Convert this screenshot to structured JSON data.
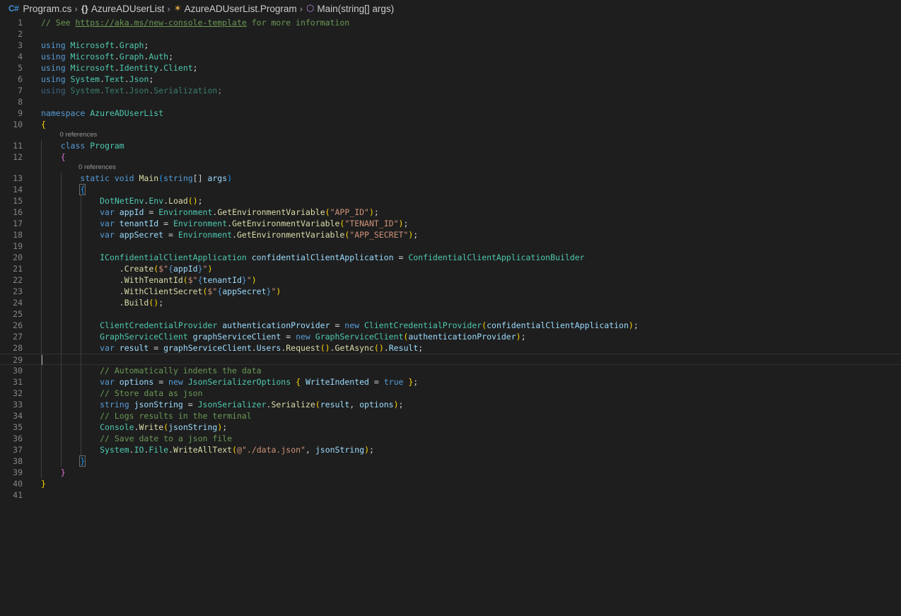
{
  "breadcrumb": {
    "file_icon": "C#",
    "file": "Program.cs",
    "namespace_icon": "{}",
    "namespace": "AzureADUserList",
    "class": "AzureADUserList.Program",
    "method": "Main(string[] args)"
  },
  "lens": {
    "class_refs": "0 references",
    "method_refs": "0 references"
  },
  "lines": [
    {
      "n": "1",
      "tokens": [
        [
          "c",
          "// See "
        ],
        [
          "link",
          "https://aka.ms/new-console-template"
        ],
        [
          "c",
          " for more information"
        ]
      ]
    },
    {
      "n": "2",
      "tokens": []
    },
    {
      "n": "3",
      "tokens": [
        [
          "k",
          "using "
        ],
        [
          "t",
          "Microsoft"
        ],
        [
          "p",
          "."
        ],
        [
          "t",
          "Graph"
        ],
        [
          "p",
          ";"
        ]
      ]
    },
    {
      "n": "4",
      "tokens": [
        [
          "k",
          "using "
        ],
        [
          "t",
          "Microsoft"
        ],
        [
          "p",
          "."
        ],
        [
          "t",
          "Graph"
        ],
        [
          "p",
          "."
        ],
        [
          "t",
          "Auth"
        ],
        [
          "p",
          ";"
        ]
      ]
    },
    {
      "n": "5",
      "tokens": [
        [
          "k",
          "using "
        ],
        [
          "t",
          "Microsoft"
        ],
        [
          "p",
          "."
        ],
        [
          "t",
          "Identity"
        ],
        [
          "p",
          "."
        ],
        [
          "t",
          "Client"
        ],
        [
          "p",
          ";"
        ]
      ]
    },
    {
      "n": "6",
      "tokens": [
        [
          "k",
          "using "
        ],
        [
          "t",
          "System"
        ],
        [
          "p",
          "."
        ],
        [
          "t",
          "Text"
        ],
        [
          "p",
          "."
        ],
        [
          "t",
          "Json"
        ],
        [
          "p",
          ";"
        ]
      ]
    },
    {
      "n": "7",
      "dim": true,
      "tokens": [
        [
          "k",
          "using "
        ],
        [
          "t",
          "System"
        ],
        [
          "p",
          "."
        ],
        [
          "t",
          "Text"
        ],
        [
          "p",
          "."
        ],
        [
          "t",
          "Json"
        ],
        [
          "p",
          "."
        ],
        [
          "t",
          "Serialization"
        ],
        [
          "p",
          ";"
        ]
      ]
    },
    {
      "n": "8",
      "tokens": []
    },
    {
      "n": "9",
      "tokens": [
        [
          "k",
          "namespace "
        ],
        [
          "t",
          "AzureADUserList"
        ]
      ]
    },
    {
      "n": "10",
      "tokens": [
        [
          "b1",
          "{"
        ]
      ]
    },
    {
      "lens": "class_refs",
      "indent": 4
    },
    {
      "n": "11",
      "tokens": [
        [
          "p",
          "    "
        ],
        [
          "k",
          "class "
        ],
        [
          "t",
          "Program"
        ]
      ]
    },
    {
      "n": "12",
      "tokens": [
        [
          "p",
          "    "
        ],
        [
          "b2",
          "{"
        ]
      ]
    },
    {
      "lens": "method_refs",
      "indent": 8
    },
    {
      "n": "13",
      "tokens": [
        [
          "p",
          "        "
        ],
        [
          "k",
          "static void "
        ],
        [
          "f",
          "Main"
        ],
        [
          "b3",
          "("
        ],
        [
          "k",
          "string"
        ],
        [
          "p",
          "[] "
        ],
        [
          "v",
          "args"
        ],
        [
          "b3",
          ")"
        ]
      ]
    },
    {
      "n": "14",
      "tokens": [
        [
          "p",
          "        "
        ],
        [
          "b3bm",
          "{"
        ]
      ]
    },
    {
      "n": "15",
      "tokens": [
        [
          "p",
          "            "
        ],
        [
          "t",
          "DotNetEnv"
        ],
        [
          "p",
          "."
        ],
        [
          "t",
          "Env"
        ],
        [
          "p",
          "."
        ],
        [
          "f",
          "Load"
        ],
        [
          "b1",
          "()"
        ],
        [
          "p",
          ";"
        ]
      ]
    },
    {
      "n": "16",
      "tokens": [
        [
          "p",
          "            "
        ],
        [
          "k",
          "var "
        ],
        [
          "v",
          "appId"
        ],
        [
          "p",
          " = "
        ],
        [
          "t",
          "Environment"
        ],
        [
          "p",
          "."
        ],
        [
          "f",
          "GetEnvironmentVariable"
        ],
        [
          "b1",
          "("
        ],
        [
          "s",
          "\"APP_ID\""
        ],
        [
          "b1",
          ")"
        ],
        [
          "p",
          ";"
        ]
      ]
    },
    {
      "n": "17",
      "tokens": [
        [
          "p",
          "            "
        ],
        [
          "k",
          "var "
        ],
        [
          "v",
          "tenantId"
        ],
        [
          "p",
          " = "
        ],
        [
          "t",
          "Environment"
        ],
        [
          "p",
          "."
        ],
        [
          "f",
          "GetEnvironmentVariable"
        ],
        [
          "b1",
          "("
        ],
        [
          "s",
          "\"TENANT_ID\""
        ],
        [
          "b1",
          ")"
        ],
        [
          "p",
          ";"
        ]
      ]
    },
    {
      "n": "18",
      "tokens": [
        [
          "p",
          "            "
        ],
        [
          "k",
          "var "
        ],
        [
          "v",
          "appSecret"
        ],
        [
          "p",
          " = "
        ],
        [
          "t",
          "Environment"
        ],
        [
          "p",
          "."
        ],
        [
          "f",
          "GetEnvironmentVariable"
        ],
        [
          "b1",
          "("
        ],
        [
          "s",
          "\"APP_SECRET\""
        ],
        [
          "b1",
          ")"
        ],
        [
          "p",
          ";"
        ]
      ]
    },
    {
      "n": "19",
      "tokens": []
    },
    {
      "n": "20",
      "tokens": [
        [
          "p",
          "            "
        ],
        [
          "t",
          "IConfidentialClientApplication "
        ],
        [
          "v",
          "confidentialClientApplication"
        ],
        [
          "p",
          " = "
        ],
        [
          "t",
          "ConfidentialClientApplicationBuilder"
        ]
      ]
    },
    {
      "n": "21",
      "tokens": [
        [
          "p",
          "                ."
        ],
        [
          "f",
          "Create"
        ],
        [
          "b1",
          "("
        ],
        [
          "s",
          "$\""
        ],
        [
          "k",
          "{"
        ],
        [
          "v",
          "appId"
        ],
        [
          "k",
          "}"
        ],
        [
          "s",
          "\""
        ],
        [
          "b1",
          ")"
        ]
      ]
    },
    {
      "n": "22",
      "tokens": [
        [
          "p",
          "                ."
        ],
        [
          "f",
          "WithTenantId"
        ],
        [
          "b1",
          "("
        ],
        [
          "s",
          "$\""
        ],
        [
          "k",
          "{"
        ],
        [
          "v",
          "tenantId"
        ],
        [
          "k",
          "}"
        ],
        [
          "s",
          "\""
        ],
        [
          "b1",
          ")"
        ]
      ]
    },
    {
      "n": "23",
      "tokens": [
        [
          "p",
          "                ."
        ],
        [
          "f",
          "WithClientSecret"
        ],
        [
          "b1",
          "("
        ],
        [
          "s",
          "$\""
        ],
        [
          "k",
          "{"
        ],
        [
          "v",
          "appSecret"
        ],
        [
          "k",
          "}"
        ],
        [
          "s",
          "\""
        ],
        [
          "b1",
          ")"
        ]
      ]
    },
    {
      "n": "24",
      "tokens": [
        [
          "p",
          "                ."
        ],
        [
          "f",
          "Build"
        ],
        [
          "b1",
          "()"
        ],
        [
          "p",
          ";"
        ]
      ]
    },
    {
      "n": "25",
      "tokens": []
    },
    {
      "n": "26",
      "tokens": [
        [
          "p",
          "            "
        ],
        [
          "t",
          "ClientCredentialProvider "
        ],
        [
          "v",
          "authenticationProvider"
        ],
        [
          "p",
          " = "
        ],
        [
          "k",
          "new "
        ],
        [
          "t",
          "ClientCredentialProvider"
        ],
        [
          "b1",
          "("
        ],
        [
          "v",
          "confidentialClientApplication"
        ],
        [
          "b1",
          ")"
        ],
        [
          "p",
          ";"
        ]
      ]
    },
    {
      "n": "27",
      "tokens": [
        [
          "p",
          "            "
        ],
        [
          "t",
          "GraphServiceClient "
        ],
        [
          "v",
          "graphServiceClient"
        ],
        [
          "p",
          " = "
        ],
        [
          "k",
          "new "
        ],
        [
          "t",
          "GraphServiceClient"
        ],
        [
          "b1",
          "("
        ],
        [
          "v",
          "authenticationProvider"
        ],
        [
          "b1",
          ")"
        ],
        [
          "p",
          ";"
        ]
      ]
    },
    {
      "n": "28",
      "tokens": [
        [
          "p",
          "            "
        ],
        [
          "k",
          "var "
        ],
        [
          "v",
          "result"
        ],
        [
          "p",
          " = "
        ],
        [
          "v",
          "graphServiceClient"
        ],
        [
          "p",
          "."
        ],
        [
          "v",
          "Users"
        ],
        [
          "p",
          "."
        ],
        [
          "f",
          "Request"
        ],
        [
          "b1",
          "()"
        ],
        [
          "p",
          "."
        ],
        [
          "f",
          "GetAsync"
        ],
        [
          "b1",
          "()"
        ],
        [
          "p",
          "."
        ],
        [
          "v",
          "Result"
        ],
        [
          "p",
          ";"
        ]
      ]
    },
    {
      "n": "29",
      "current": true,
      "tokens": []
    },
    {
      "n": "30",
      "tokens": [
        [
          "p",
          "            "
        ],
        [
          "c",
          "// Automatically indents the data"
        ]
      ]
    },
    {
      "n": "31",
      "tokens": [
        [
          "p",
          "            "
        ],
        [
          "k",
          "var "
        ],
        [
          "v",
          "options"
        ],
        [
          "p",
          " = "
        ],
        [
          "k",
          "new "
        ],
        [
          "t",
          "JsonSerializerOptions "
        ],
        [
          "b1",
          "{ "
        ],
        [
          "v",
          "WriteIndented"
        ],
        [
          "p",
          " = "
        ],
        [
          "k",
          "true"
        ],
        [
          "b1",
          " }"
        ],
        [
          "p",
          ";"
        ]
      ]
    },
    {
      "n": "32",
      "tokens": [
        [
          "p",
          "            "
        ],
        [
          "c",
          "// Store data as json"
        ]
      ]
    },
    {
      "n": "33",
      "tokens": [
        [
          "p",
          "            "
        ],
        [
          "k",
          "string "
        ],
        [
          "v",
          "jsonString"
        ],
        [
          "p",
          " = "
        ],
        [
          "t",
          "JsonSerializer"
        ],
        [
          "p",
          "."
        ],
        [
          "f",
          "Serialize"
        ],
        [
          "b1",
          "("
        ],
        [
          "v",
          "result"
        ],
        [
          "p",
          ", "
        ],
        [
          "v",
          "options"
        ],
        [
          "b1",
          ")"
        ],
        [
          "p",
          ";"
        ]
      ]
    },
    {
      "n": "34",
      "tokens": [
        [
          "p",
          "            "
        ],
        [
          "c",
          "// Logs results in the terminal"
        ]
      ]
    },
    {
      "n": "35",
      "tokens": [
        [
          "p",
          "            "
        ],
        [
          "t",
          "Console"
        ],
        [
          "p",
          "."
        ],
        [
          "f",
          "Write"
        ],
        [
          "b1",
          "("
        ],
        [
          "v",
          "jsonString"
        ],
        [
          "b1",
          ")"
        ],
        [
          "p",
          ";"
        ]
      ]
    },
    {
      "n": "36",
      "tokens": [
        [
          "p",
          "            "
        ],
        [
          "c",
          "// Save date to a json file"
        ]
      ]
    },
    {
      "n": "37",
      "tokens": [
        [
          "p",
          "            "
        ],
        [
          "t",
          "System"
        ],
        [
          "p",
          "."
        ],
        [
          "t",
          "IO"
        ],
        [
          "p",
          "."
        ],
        [
          "t",
          "File"
        ],
        [
          "p",
          "."
        ],
        [
          "f",
          "WriteAllText"
        ],
        [
          "b1",
          "("
        ],
        [
          "s",
          "@\"./data.json\""
        ],
        [
          "p",
          ", "
        ],
        [
          "v",
          "jsonString"
        ],
        [
          "b1",
          ")"
        ],
        [
          "p",
          ";"
        ]
      ]
    },
    {
      "n": "38",
      "tokens": [
        [
          "p",
          "        "
        ],
        [
          "b3bm",
          "}"
        ]
      ]
    },
    {
      "n": "39",
      "tokens": [
        [
          "p",
          "    "
        ],
        [
          "b2",
          "}"
        ]
      ]
    },
    {
      "n": "40",
      "tokens": [
        [
          "b1",
          "}"
        ]
      ]
    },
    {
      "n": "41",
      "tokens": []
    }
  ]
}
